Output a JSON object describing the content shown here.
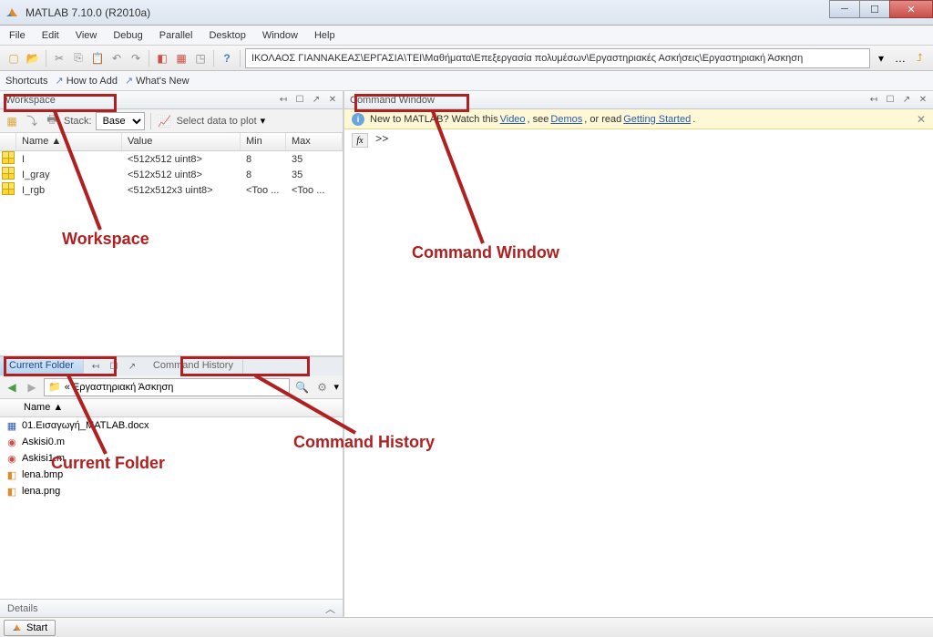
{
  "window": {
    "title": "MATLAB 7.10.0 (R2010a)",
    "min_symbol": "─",
    "max_symbol": "☐",
    "close_symbol": "✕"
  },
  "menubar": [
    "File",
    "Edit",
    "View",
    "Debug",
    "Parallel",
    "Desktop",
    "Window",
    "Help"
  ],
  "toolbar": {
    "path": "ΙΚΟΛΑΟΣ ΓΙΑΝΝΑΚΕΑΣ\\ΕΡΓΑΣΙΑ\\ΤΕΙ\\Μαθήματα\\Επεξεργασία πολυμέσων\\Εργαστηριακές Ασκήσεις\\Εργαστηριακή Άσκηση"
  },
  "shortcuts": {
    "label": "Shortcuts",
    "items": [
      "How to Add",
      "What's New"
    ]
  },
  "workspace": {
    "title": "Workspace",
    "stack_label": "Stack:",
    "stack_value": "Base",
    "plot_label": "Select data to plot",
    "columns": [
      "Name ▲",
      "Value",
      "Min",
      "Max"
    ],
    "rows": [
      {
        "name": "I",
        "value": "<512x512 uint8>",
        "min": "8",
        "max": "35"
      },
      {
        "name": "I_gray",
        "value": "<512x512 uint8>",
        "min": "8",
        "max": "35"
      },
      {
        "name": "I_rgb",
        "value": "<512x512x3 uint8>",
        "min": "<Too ...",
        "max": "<Too ..."
      }
    ]
  },
  "tabs": {
    "current_folder": "Current Folder",
    "command_history": "Command History"
  },
  "current_folder": {
    "breadcrumb": "« Εργαστηριακή Άσκηση",
    "name_col": "Name ▲",
    "files": [
      {
        "name": "01.Εισαγωγή_MATLAB.docx",
        "type": "doc"
      },
      {
        "name": "Askisi0.m",
        "type": "m"
      },
      {
        "name": "Askisi1.m",
        "type": "m"
      },
      {
        "name": "lena.bmp",
        "type": "img"
      },
      {
        "name": "lena.png",
        "type": "img"
      }
    ],
    "details_label": "Details"
  },
  "command_window": {
    "title": "Command Window",
    "info_prefix": "New to MATLAB? Watch this ",
    "video_link": "Video",
    "info_mid1": ", see ",
    "demos_link": "Demos",
    "info_mid2": ", or read ",
    "getting_started_link": "Getting Started",
    "info_suffix": ".",
    "prompt": ">>",
    "fx": "fx"
  },
  "start": "Start",
  "panel_controls": {
    "expand_left": "↤",
    "dock": "☐",
    "maximize": "↗",
    "close": "✕"
  },
  "annotations": {
    "workspace": "Workspace",
    "command_window": "Command Window",
    "current_folder": "Current Folder",
    "command_history": "Command History"
  }
}
